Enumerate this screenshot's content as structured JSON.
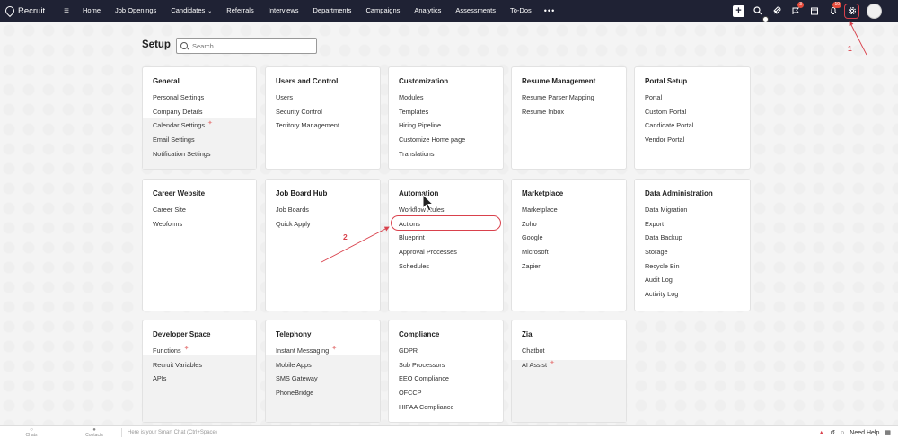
{
  "app": {
    "name": "Recruit"
  },
  "nav": [
    {
      "label": "Home"
    },
    {
      "label": "Job Openings"
    },
    {
      "label": "Candidates",
      "dropdown": true
    },
    {
      "label": "Referrals"
    },
    {
      "label": "Interviews"
    },
    {
      "label": "Departments"
    },
    {
      "label": "Campaigns"
    },
    {
      "label": "Analytics"
    },
    {
      "label": "Assessments"
    },
    {
      "label": "To-Dos"
    }
  ],
  "nav_more": "•••",
  "header_icons": {
    "plus": "+",
    "search": "search-icon",
    "rocket": "rocket-icon",
    "tasks_badge": "3",
    "calendar": "calendar-icon",
    "notifications_badge": "10",
    "settings": "gear-icon"
  },
  "setup": {
    "title": "Setup",
    "search_placeholder": "Search"
  },
  "cards": {
    "general": {
      "title": "General",
      "items": [
        "Personal Settings",
        "Company Details",
        "Calendar Settings",
        "Email Settings",
        "Notification Settings"
      ]
    },
    "users": {
      "title": "Users and Control",
      "items": [
        "Users",
        "Security Control",
        "Territory Management"
      ]
    },
    "customization": {
      "title": "Customization",
      "items": [
        "Modules",
        "Templates",
        "Hiring Pipeline",
        "Customize Home page",
        "Translations"
      ]
    },
    "resume": {
      "title": "Resume Management",
      "items": [
        "Resume Parser Mapping",
        "Resume Inbox"
      ]
    },
    "portal": {
      "title": "Portal Setup",
      "items": [
        "Portal",
        "Custom Portal",
        "Candidate Portal",
        "Vendor Portal"
      ]
    },
    "career": {
      "title": "Career Website",
      "items": [
        "Career Site",
        "Webforms"
      ]
    },
    "jobboard": {
      "title": "Job Board Hub",
      "items": [
        "Job Boards",
        "Quick Apply"
      ]
    },
    "automation": {
      "title": "Automation",
      "items": [
        "Workflow Rules",
        "Actions",
        "Blueprint",
        "Approval Processes",
        "Schedules"
      ]
    },
    "marketplace": {
      "title": "Marketplace",
      "items": [
        "Marketplace",
        "Zoho",
        "Google",
        "Microsoft",
        "Zapier"
      ]
    },
    "dataadmin": {
      "title": "Data Administration",
      "items": [
        "Data Migration",
        "Export",
        "Data Backup",
        "Storage",
        "Recycle Bin",
        "Audit Log",
        "Activity Log"
      ]
    },
    "developer": {
      "title": "Developer Space",
      "items": [
        "Functions",
        "Recruit Variables",
        "APIs"
      ]
    },
    "telephony": {
      "title": "Telephony",
      "items": [
        "Instant Messaging",
        "Mobile Apps",
        "SMS Gateway",
        "PhoneBridge"
      ]
    },
    "compliance": {
      "title": "Compliance",
      "items": [
        "GDPR",
        "Sub Processors",
        "EEO Compliance",
        "OFCCP",
        "HIPAA Compliance"
      ]
    },
    "zia": {
      "title": "Zia",
      "items": [
        "Chatbot",
        "AI Assist"
      ]
    }
  },
  "annotations": {
    "one": "1",
    "two": "2"
  },
  "bottom": {
    "chats": "Chats",
    "contacts": "Contacts",
    "smart_chat": "Here is your Smart Chat (Ctrl+Space)",
    "need_help": "Need Help"
  },
  "colors": {
    "nav_bg": "#1f2234",
    "annotation": "#d9414c",
    "badge": "#e54b3c"
  }
}
